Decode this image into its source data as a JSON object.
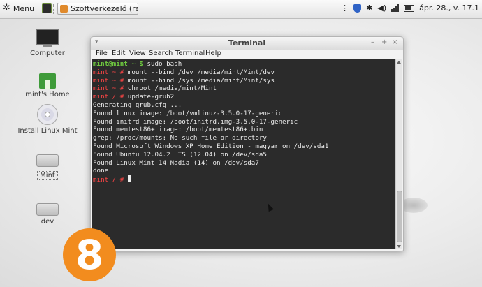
{
  "panel": {
    "menu_label": "Menu",
    "task_label": "Szoftverkezelő (rends...",
    "clock": "ápr. 28., v. 17.1"
  },
  "desktop": {
    "icons": [
      {
        "label": "Computer",
        "icon": "computer-icon"
      },
      {
        "label": "mint's Home",
        "icon": "home-folder-icon"
      },
      {
        "label": "Install Linux Mint",
        "icon": "cd-install-icon"
      },
      {
        "label": "Mint",
        "icon": "drive-icon"
      },
      {
        "label": "dev",
        "icon": "drive-icon"
      }
    ]
  },
  "badge": {
    "number": "8",
    "color": "#f28c1e"
  },
  "terminal": {
    "title": "Terminal",
    "menu": [
      "File",
      "Edit",
      "View",
      "Search",
      "Terminal",
      "Help"
    ],
    "lines": [
      {
        "prompt": "mint@mint ~ $",
        "text": " sudo bash"
      },
      {
        "prompt": "mint ~ #",
        "text": " mount --bind /dev /media/mint/Mint/dev"
      },
      {
        "prompt": "mint ~ #",
        "text": " mount --bind /sys /media/mint/Mint/sys"
      },
      {
        "prompt": "mint ~ #",
        "text": " chroot /media/mint/Mint"
      },
      {
        "prompt": "mint / #",
        "text": " update-grub2"
      },
      {
        "prompt": "",
        "text": "Generating grub.cfg ..."
      },
      {
        "prompt": "",
        "text": "Found linux image: /boot/vmlinuz-3.5.0-17-generic"
      },
      {
        "prompt": "",
        "text": "Found initrd image: /boot/initrd.img-3.5.0-17-generic"
      },
      {
        "prompt": "",
        "text": "Found memtest86+ image: /boot/memtest86+.bin"
      },
      {
        "prompt": "",
        "text": "grep: /proc/mounts: No such file or directory"
      },
      {
        "prompt": "",
        "text": "Found Microsoft Windows XP Home Edition - magyar on /dev/sda1"
      },
      {
        "prompt": "",
        "text": "Found Ubuntu 12.04.2 LTS (12.04) on /dev/sda5"
      },
      {
        "prompt": "",
        "text": "Found Linux Mint 14 Nadia (14) on /dev/sda7"
      },
      {
        "prompt": "",
        "text": "done"
      },
      {
        "prompt": "mint / #",
        "text": " "
      }
    ],
    "colors": {
      "background": "#2b2b2b",
      "prompt": "#ff4545",
      "user_prompt": "#6ec93f"
    }
  }
}
